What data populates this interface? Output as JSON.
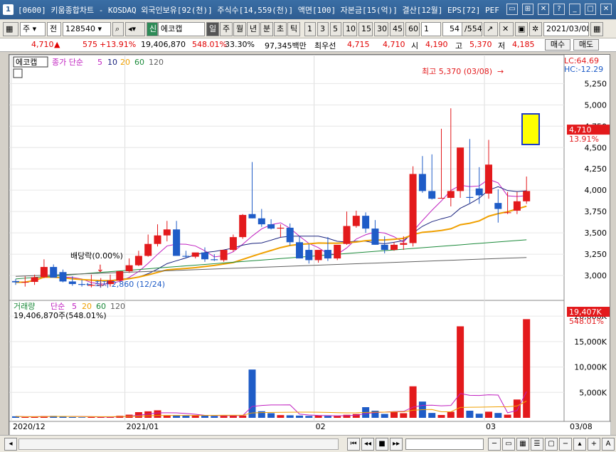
{
  "title_bar": {
    "window_index": "1",
    "title": "[0600] 키움종합차트 - KOSDAQ 외국인보유[92(천)] 주식수[14,559(천)] 액면[100] 자본금[15(억)] 결산[12월] EPS[72] PEF"
  },
  "toolbar": {
    "period_label": "주",
    "type_label": "전",
    "code": "128540",
    "badge": "신",
    "stock_name": "에코캡",
    "period_tabs": [
      "일",
      "주",
      "월",
      "년",
      "분",
      "초",
      "틱"
    ],
    "minute_steps": [
      "1",
      "3",
      "5",
      "10",
      "15",
      "30",
      "45",
      "60"
    ],
    "step_value": "1",
    "page_counter": "54",
    "page_total": "/554",
    "date": "2021/03/08"
  },
  "quote": {
    "price": "4,710",
    "arrow": "▲",
    "change": "575",
    "change_pct": "+13.91%",
    "volume": "19,406,870",
    "volume_pct": "548.01%",
    "turnover_pct": "33.30%",
    "amount": "97,345백만",
    "rank_label": "최우선",
    "ask": "4,715",
    "bid": "4,710",
    "open_label": "시",
    "open": "4,190",
    "high_label": "고",
    "high": "5,370",
    "low_label": "저",
    "low": "4,185",
    "buy_label": "매수",
    "sell_label": "매도"
  },
  "chart_labels": {
    "price_pane_name": "에코캡",
    "ma_header": "종가 단순",
    "ma_periods": [
      "5",
      "10",
      "20",
      "60",
      "120"
    ],
    "lc": "LC:64.69",
    "hc": "HC:-12.29",
    "high_note": "최고 5,370 (03/08)",
    "div_note": "배당락(0.00%)",
    "low_note": "최저 2,860 (12/24)",
    "price_flag": "4,710",
    "pct_flag": "13.91%",
    "volume_pane_name": "거래량",
    "volume_ma_header": "단순",
    "volume_ma_periods": [
      "5",
      "20",
      "60",
      "120"
    ],
    "volume_value": "19,406,870주(548.01%)",
    "vol_flag": "19,407K",
    "vol_pct_flag": "548.01%",
    "date_end": "03/08"
  },
  "colors": {
    "up": "#e31a1c",
    "down": "#1f5cc7",
    "ma5": "#c020c0",
    "ma10": "#1a237e",
    "ma20": "#f0a000",
    "ma60": "#1b8a3a",
    "ma120": "#606060"
  },
  "chart_data": [
    {
      "type": "candlestick",
      "title": "에코캡",
      "x": [
        "2020-12-14",
        "2020-12-15",
        "2020-12-16",
        "2020-12-17",
        "2020-12-18",
        "2020-12-21",
        "2020-12-22",
        "2020-12-23",
        "2020-12-24",
        "2020-12-28",
        "2020-12-29",
        "2020-12-30",
        "2021-01-04",
        "2021-01-05",
        "2021-01-06",
        "2021-01-07",
        "2021-01-08",
        "2021-01-11",
        "2021-01-12",
        "2021-01-13",
        "2021-01-14",
        "2021-01-15",
        "2021-01-18",
        "2021-01-19",
        "2021-01-20",
        "2021-01-21",
        "2021-01-22",
        "2021-01-25",
        "2021-01-26",
        "2021-01-27",
        "2021-01-28",
        "2021-01-29",
        "2021-02-01",
        "2021-02-02",
        "2021-02-03",
        "2021-02-04",
        "2021-02-05",
        "2021-02-08",
        "2021-02-09",
        "2021-02-10",
        "2021-02-15",
        "2021-02-16",
        "2021-02-17",
        "2021-02-18",
        "2021-02-19",
        "2021-02-22",
        "2021-02-23",
        "2021-02-24",
        "2021-02-25",
        "2021-02-26",
        "2021-03-02",
        "2021-03-03",
        "2021-03-04",
        "2021-03-05",
        "2021-03-08"
      ],
      "open": [
        2935,
        2920,
        2925,
        2980,
        3100,
        3040,
        2930,
        2900,
        2880,
        2890,
        2900,
        2940,
        3050,
        3120,
        3230,
        3370,
        3470,
        3540,
        3230,
        3220,
        3270,
        3190,
        3180,
        3300,
        3450,
        3720,
        3670,
        3600,
        3550,
        3560,
        3390,
        3300,
        3180,
        3300,
        3200,
        3370,
        3580,
        3700,
        3550,
        3360,
        3300,
        3360,
        3380,
        4190,
        3990,
        3910,
        3910,
        3990,
        3920,
        4020,
        3960,
        3850,
        3740,
        3760,
        3870
      ],
      "high": [
        2960,
        2990,
        3010,
        3190,
        3130,
        3070,
        2990,
        2950,
        3010,
        2970,
        3010,
        3050,
        3200,
        3290,
        3480,
        3600,
        3640,
        3640,
        3290,
        3260,
        3330,
        3250,
        3230,
        3480,
        3720,
        4330,
        3780,
        3660,
        3600,
        3610,
        3460,
        3370,
        3270,
        3450,
        3340,
        3750,
        3760,
        3740,
        3650,
        3460,
        3390,
        3460,
        4280,
        4400,
        4420,
        4720,
        4960,
        4250,
        4600,
        4270,
        4590,
        4010,
        3980,
        3980,
        4160
      ],
      "low": [
        2890,
        2870,
        2890,
        2970,
        3000,
        2920,
        2880,
        2870,
        2860,
        2860,
        2870,
        2930,
        3030,
        3110,
        3220,
        3340,
        3400,
        3240,
        3200,
        3200,
        3160,
        3170,
        3160,
        3280,
        3430,
        3670,
        3570,
        3540,
        3450,
        3350,
        3240,
        3140,
        3150,
        3170,
        3180,
        3360,
        3560,
        3500,
        3360,
        3260,
        3290,
        3300,
        3340,
        3970,
        3890,
        3900,
        3810,
        3910,
        3850,
        3840,
        3900,
        3620,
        3720,
        3720,
        3840
      ],
      "close": [
        2920,
        2925,
        2980,
        3100,
        2975,
        2930,
        2900,
        2890,
        2890,
        2890,
        2940,
        3050,
        3120,
        3230,
        3370,
        3470,
        3540,
        3230,
        3220,
        3270,
        3190,
        3180,
        3300,
        3450,
        3710,
        3670,
        3600,
        3550,
        3560,
        3390,
        3200,
        3180,
        3300,
        3200,
        3360,
        3580,
        3700,
        3550,
        3360,
        3300,
        3360,
        3380,
        4190,
        3990,
        3900,
        3910,
        3990,
        4500,
        3910,
        3940,
        4300,
        3780,
        3740,
        3870,
        3990
      ],
      "ylim": [
        2750,
        5420
      ],
      "yticks": [
        3000,
        3250,
        3500,
        3750,
        4000,
        4250,
        4500,
        4750,
        5000,
        5250
      ],
      "x_labels": [
        "2020/12",
        "2021/01",
        "02",
        "03"
      ]
    },
    {
      "type": "bar",
      "title": "거래량",
      "values_k": [
        300,
        150,
        210,
        350,
        380,
        300,
        160,
        110,
        170,
        160,
        230,
        410,
        620,
        1120,
        1280,
        1480,
        500,
        520,
        470,
        520,
        430,
        380,
        390,
        510,
        460,
        9500,
        1300,
        920,
        540,
        500,
        440,
        380,
        470,
        370,
        340,
        600,
        750,
        2100,
        1400,
        770,
        1170,
        910,
        6200,
        3200,
        960,
        560,
        1200,
        18000,
        1400,
        810,
        1210,
        950,
        620,
        3600,
        19407
      ],
      "ylim": [
        0,
        21000
      ],
      "yticks_labels": [
        "5,000K",
        "10,000K",
        "15,000K",
        "20,000K"
      ]
    }
  ]
}
